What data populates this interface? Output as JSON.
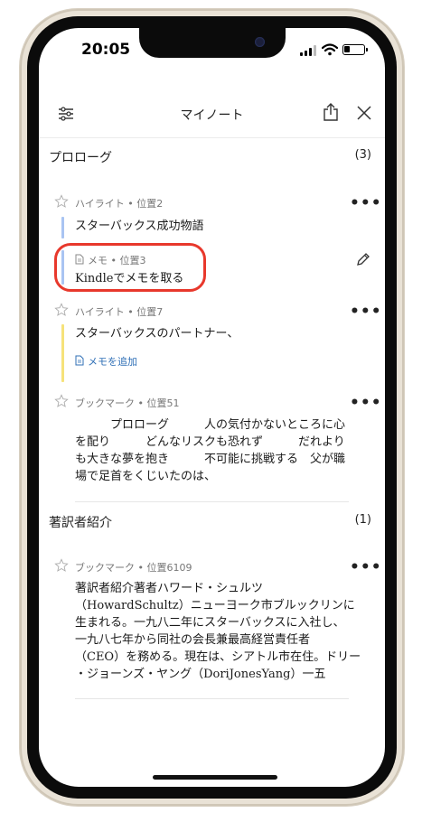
{
  "status": {
    "time": "20:05"
  },
  "nav": {
    "title": "マイノート"
  },
  "sections": [
    {
      "title": "プロローグ",
      "count": "(3)",
      "items": [
        {
          "type_label": "ハイライト • 位置2",
          "text": "スターバックス成功物語",
          "note": {
            "label": "メモ • 位置3",
            "text": "Kindleでメモを取る"
          }
        },
        {
          "type_label": "ハイライト • 位置7",
          "text": "スターバックスのパートナー、",
          "add_note": "メモを追加"
        },
        {
          "type_label": "ブックマーク • 位置51",
          "lines": [
            "　　　プロローグ　　　人の気付かないところに心",
            "を配り　　　どんなリスクも恐れず　　　だれより",
            "も大きな夢を抱き　　　不可能に挑戦する　父が職",
            "場で足首をくじいたのは、"
          ]
        }
      ]
    },
    {
      "title": "著訳者紹介",
      "count": "(1)",
      "items": [
        {
          "type_label": "ブックマーク • 位置6109",
          "lines": [
            "著訳者紹介著者ハワード・シュルツ",
            "（HowardSchultz）ニューヨーク市ブルックリンに",
            "生まれる。一九八二年にスターバックスに入社し、",
            "一九八七年から同社の会長兼最高経営責任者",
            "（CEO）を務める。現在は、シアトル市在住。ドリー",
            "・ジョーンズ・ヤング（DoriJonesYang）一五"
          ]
        }
      ]
    }
  ],
  "colors": {
    "highlight_blue": "#a9c4f2",
    "highlight_yellow": "#f6e27a",
    "annotation_ring": "#e8382c",
    "link": "#2f6fb6"
  },
  "icons": [
    "filter-icon",
    "share-icon",
    "close-icon",
    "star-icon",
    "more-icon",
    "note-icon",
    "pencil-icon"
  ]
}
